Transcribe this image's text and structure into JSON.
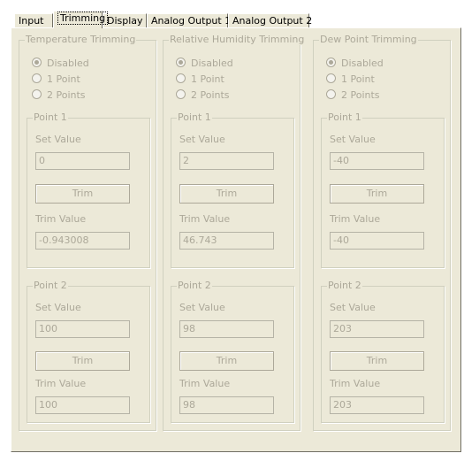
{
  "tabs": [
    {
      "label": "Input"
    },
    {
      "label": "Trimming"
    },
    {
      "label": "Display"
    },
    {
      "label": "Analog Output 1"
    },
    {
      "label": "Analog Output 2"
    }
  ],
  "groups": [
    {
      "title": "Temperature Trimming",
      "options": [
        "Disabled",
        "1 Point",
        "2 Points"
      ],
      "selected": "Disabled",
      "point1": {
        "title": "Point 1",
        "set_label": "Set Value",
        "set_value": "0",
        "trim_label": "Trim",
        "trim_value_label": "Trim Value",
        "trim_value": "-0.943008"
      },
      "point2": {
        "title": "Point 2",
        "set_label": "Set Value",
        "set_value": "100",
        "trim_label": "Trim",
        "trim_value_label": "Trim Value",
        "trim_value": "100"
      }
    },
    {
      "title": "Relative Humidity Trimming",
      "options": [
        "Disabled",
        "1 Point",
        "2 Points"
      ],
      "selected": "Disabled",
      "point1": {
        "title": "Point 1",
        "set_label": "Set Value",
        "set_value": "2",
        "trim_label": "Trim",
        "trim_value_label": "Trim Value",
        "trim_value": "46.743"
      },
      "point2": {
        "title": "Point 2",
        "set_label": "Set Value",
        "set_value": "98",
        "trim_label": "Trim",
        "trim_value_label": "Trim Value",
        "trim_value": "98"
      }
    },
    {
      "title": "Dew Point Trimming",
      "options": [
        "Disabled",
        "1 Point",
        "2 Points"
      ],
      "selected": "Disabled",
      "point1": {
        "title": "Point 1",
        "set_label": "Set Value",
        "set_value": "-40",
        "trim_label": "Trim",
        "trim_value_label": "Trim Value",
        "trim_value": "-40"
      },
      "point2": {
        "title": "Point 2",
        "set_label": "Set Value",
        "set_value": "203",
        "trim_label": "Trim",
        "trim_value_label": "Trim Value",
        "trim_value": "203"
      }
    }
  ]
}
